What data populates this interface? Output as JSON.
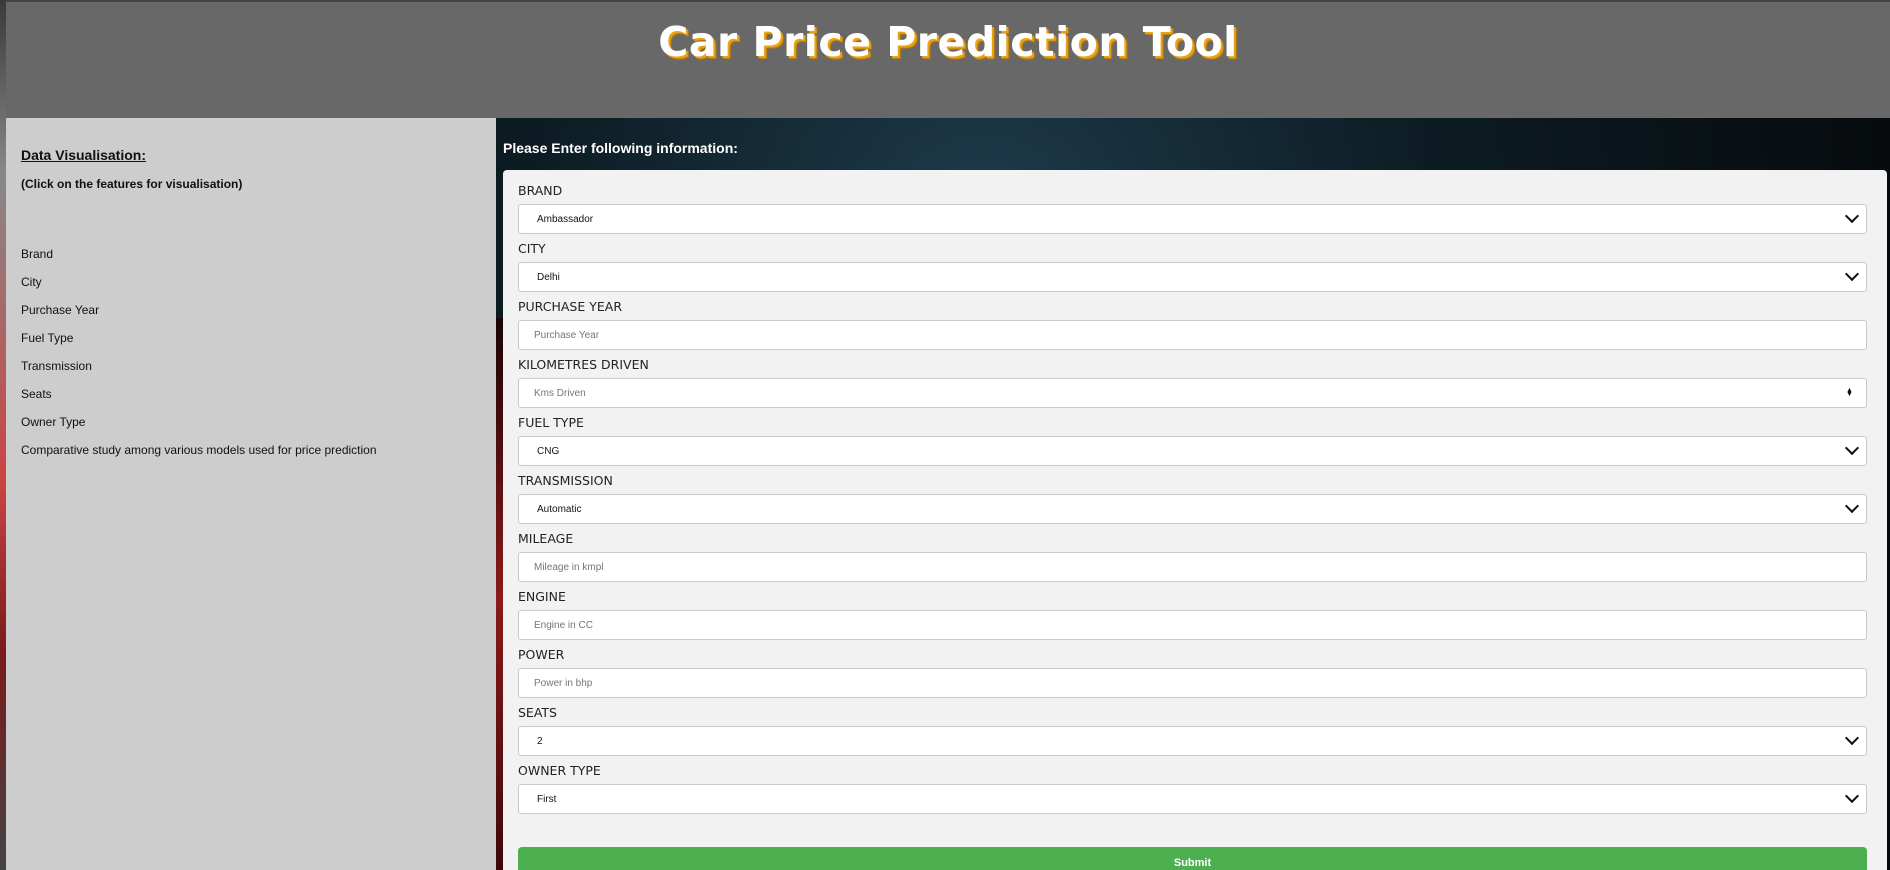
{
  "header": {
    "title": "Car Price Prediction Tool"
  },
  "sidebar": {
    "title": "Data Visualisation:",
    "subtitle": "(Click on the features for visualisation)",
    "items": [
      "Brand",
      "City",
      "Purchase Year",
      "Fuel Type",
      "Transmission",
      "Seats",
      "Owner Type",
      "Comparative study among various models used for price prediction"
    ]
  },
  "form": {
    "prompt": "Please Enter following information:",
    "brand": {
      "label": "BRAND",
      "value": "Ambassador"
    },
    "city": {
      "label": "CITY",
      "value": "Delhi"
    },
    "purchase_year": {
      "label": "PURCHASE YEAR",
      "placeholder": "Purchase Year"
    },
    "kms_driven": {
      "label": "KILOMETRES DRIVEN",
      "placeholder": "Kms Driven"
    },
    "fuel_type": {
      "label": "FUEL TYPE",
      "value": "CNG"
    },
    "transmission": {
      "label": "TRANSMISSION",
      "value": "Automatic"
    },
    "mileage": {
      "label": "MILEAGE",
      "placeholder": "Mileage in kmpl"
    },
    "engine": {
      "label": "ENGINE",
      "placeholder": "Engine in CC"
    },
    "power": {
      "label": "POWER",
      "placeholder": "Power in bhp"
    },
    "seats": {
      "label": "SEATS",
      "value": "2"
    },
    "owner_type": {
      "label": "OWNER TYPE",
      "value": "First"
    },
    "submit_label": "Submit"
  },
  "colors": {
    "submit": "#4caf50",
    "header": "#686868",
    "sidebar": "#cdcdcd",
    "form": "#f2f2f2"
  }
}
